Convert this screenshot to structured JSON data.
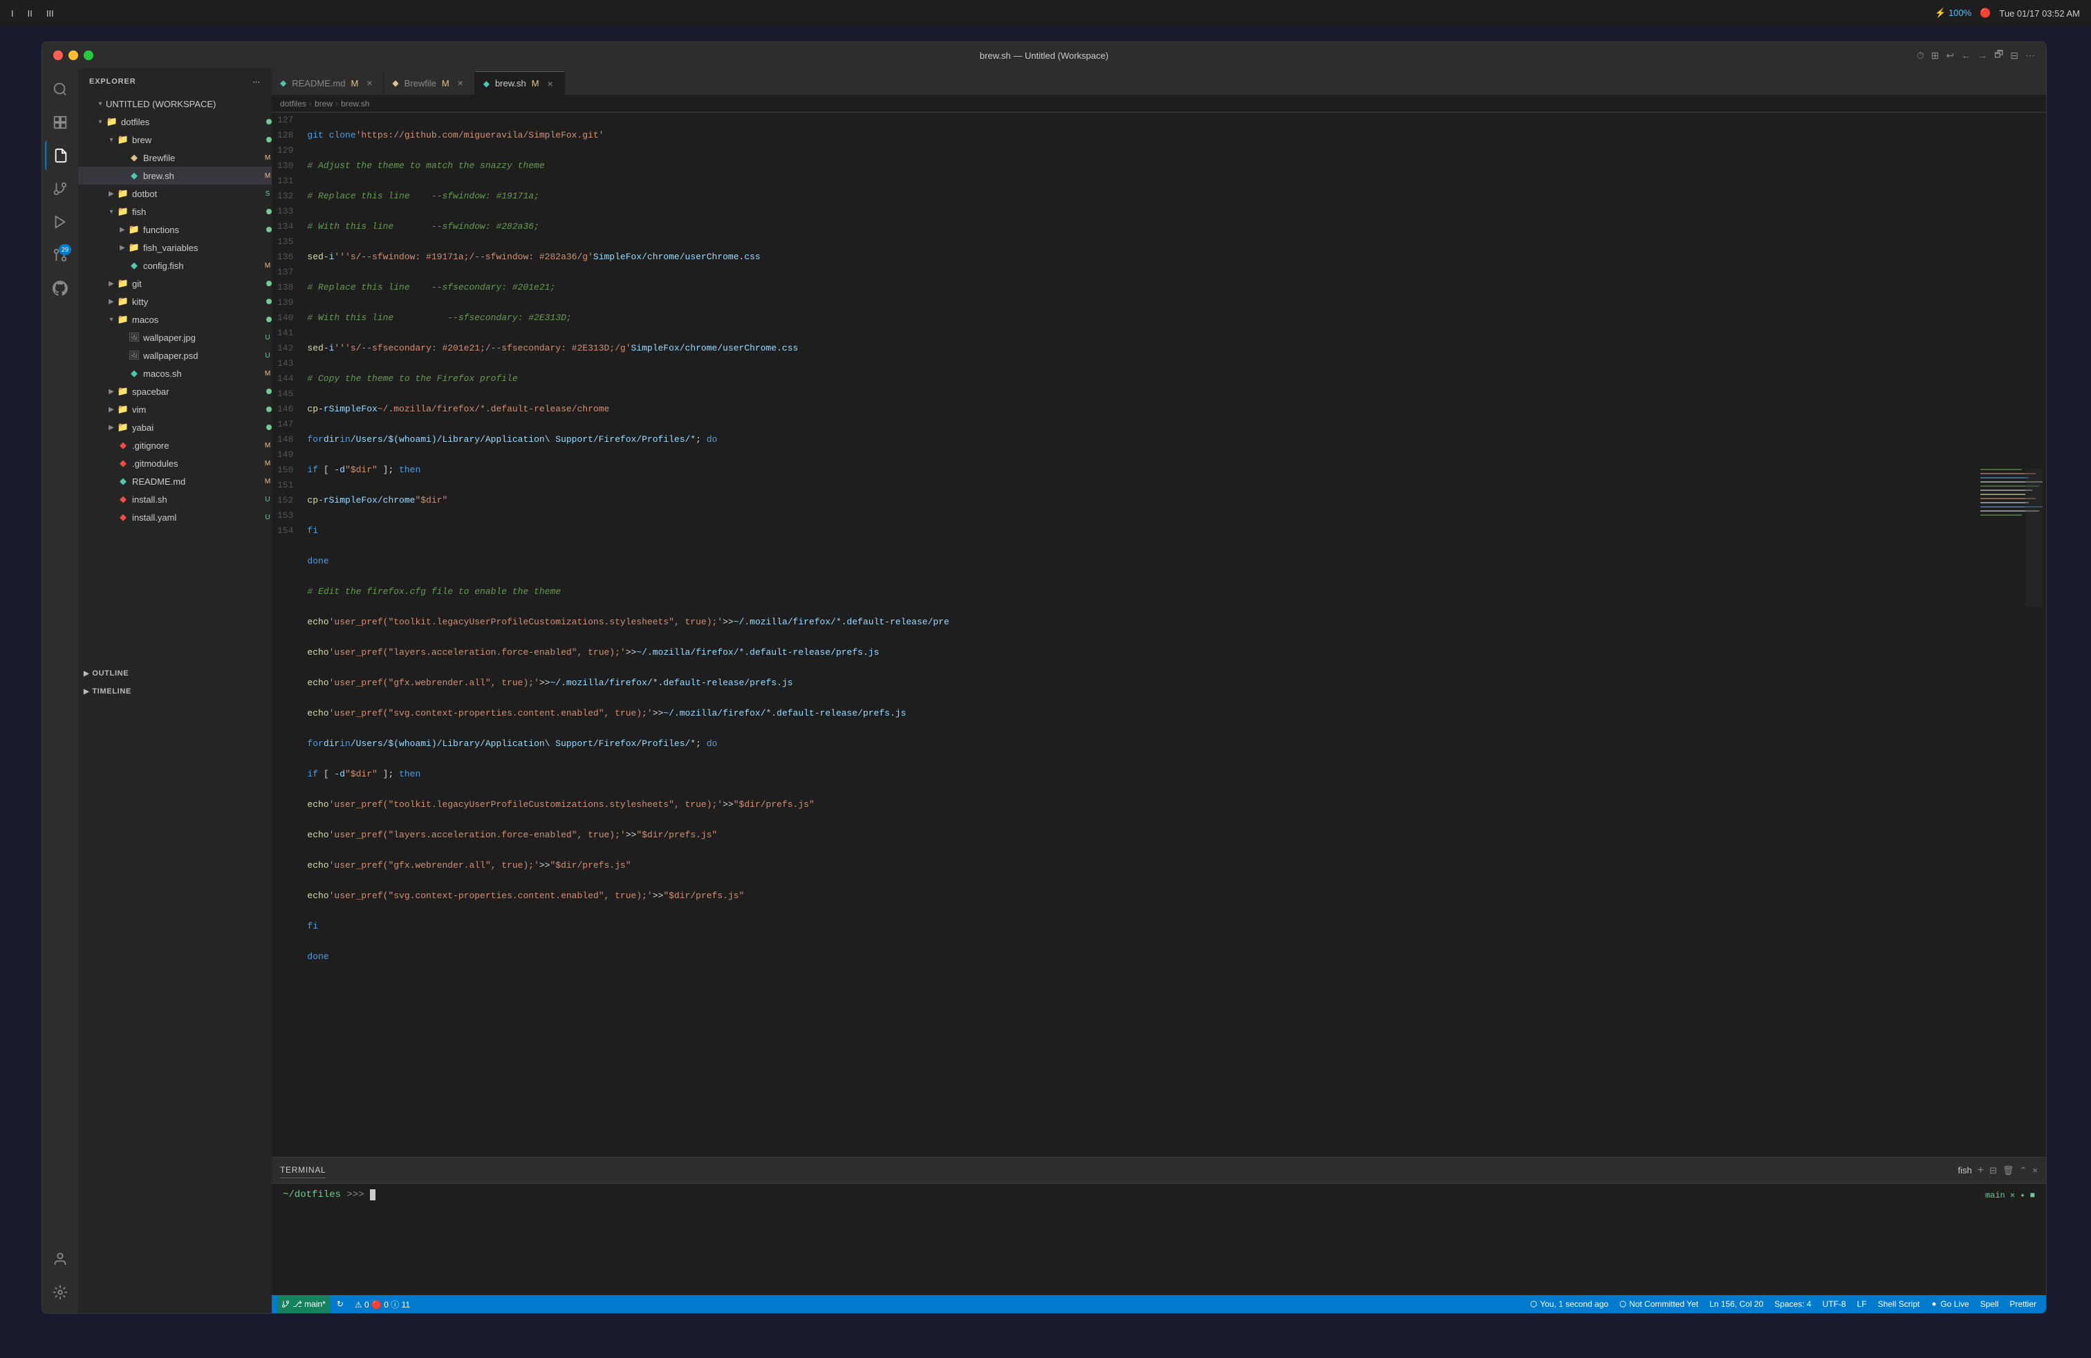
{
  "menu_bar": {
    "items": [
      "I",
      "II",
      "III"
    ],
    "right": {
      "battery": "⚡ 100%",
      "indicator": "🔴",
      "time": "Tue 01/17  03:52 AM"
    }
  },
  "window": {
    "title": "brew.sh — Untitled (Workspace)"
  },
  "tabs": [
    {
      "id": "readme",
      "label": "README.md",
      "modified": true,
      "active": false,
      "icon": "📄",
      "color": "#4ec9b0"
    },
    {
      "id": "brewfile",
      "label": "Brewfile",
      "modified": true,
      "active": false,
      "icon": "📄",
      "color": "#e2c08d"
    },
    {
      "id": "brew",
      "label": "brew.sh",
      "modified": true,
      "active": true,
      "icon": "📄",
      "color": "#4ec9b0"
    }
  ],
  "breadcrumb": {
    "parts": [
      "dotfiles",
      "brew",
      "brew.sh"
    ]
  },
  "sidebar": {
    "title": "EXPLORER",
    "workspace": "UNTITLED (WORKSPACE)",
    "files": [
      {
        "indent": 1,
        "type": "dir",
        "open": true,
        "label": "dotfiles",
        "badge": ""
      },
      {
        "indent": 2,
        "type": "dir",
        "open": true,
        "label": "brew",
        "badge": ""
      },
      {
        "indent": 3,
        "type": "file",
        "label": "Brewfile",
        "badge": "M",
        "badgeClass": "badge-M"
      },
      {
        "indent": 3,
        "type": "file",
        "label": "brew.sh",
        "badge": "M",
        "badgeClass": "badge-M",
        "selected": true
      },
      {
        "indent": 2,
        "type": "dir",
        "open": false,
        "label": "dotbot",
        "badge": "S",
        "badgeClass": "badge-S"
      },
      {
        "indent": 2,
        "type": "dir",
        "open": true,
        "label": "fish",
        "badge": ""
      },
      {
        "indent": 3,
        "type": "dir",
        "open": true,
        "label": "functions",
        "badge": ""
      },
      {
        "indent": 3,
        "type": "dir",
        "open": false,
        "label": "fish_variables",
        "badge": ""
      },
      {
        "indent": 3,
        "type": "file",
        "label": "config.fish",
        "badge": "M",
        "badgeClass": "badge-M"
      },
      {
        "indent": 2,
        "type": "dir",
        "open": false,
        "label": "git",
        "badge": ""
      },
      {
        "indent": 2,
        "type": "dir",
        "open": false,
        "label": "kitty",
        "badge": ""
      },
      {
        "indent": 2,
        "type": "dir",
        "open": true,
        "label": "macos",
        "badge": ""
      },
      {
        "indent": 3,
        "type": "file",
        "label": "wallpaper.jpg",
        "badge": "U",
        "badgeClass": "badge-U"
      },
      {
        "indent": 3,
        "type": "file",
        "label": "wallpaper.psd",
        "badge": "U",
        "badgeClass": "badge-U"
      },
      {
        "indent": 3,
        "type": "file",
        "label": "macos.sh",
        "badge": "M",
        "badgeClass": "badge-M"
      },
      {
        "indent": 2,
        "type": "dir",
        "open": false,
        "label": "spacebar",
        "badge": ""
      },
      {
        "indent": 2,
        "type": "dir",
        "open": false,
        "label": "vim",
        "badge": ""
      },
      {
        "indent": 2,
        "type": "dir",
        "open": false,
        "label": "yabai",
        "badge": ""
      },
      {
        "indent": 2,
        "type": "file",
        "label": ".gitignore",
        "badge": "M",
        "badgeClass": "badge-M"
      },
      {
        "indent": 2,
        "type": "file",
        "label": ".gitmodules",
        "badge": "M",
        "badgeClass": "badge-M"
      },
      {
        "indent": 2,
        "type": "file",
        "label": "README.md",
        "badge": "M",
        "badgeClass": "badge-M"
      },
      {
        "indent": 2,
        "type": "file",
        "label": "install.sh",
        "badge": "U",
        "badgeClass": "badge-U"
      },
      {
        "indent": 2,
        "type": "file",
        "label": "install.yaml",
        "badge": "U",
        "badgeClass": "badge-U"
      }
    ]
  },
  "code_lines": [
    {
      "num": 127,
      "content": "  git clone 'https://github.com/migueravila/SimpleFox.git'"
    },
    {
      "num": 128,
      "content": "  # Adjust the theme to match the snazzy theme"
    },
    {
      "num": 129,
      "content": "  # Replace this line    --sfwindow: #19171a;"
    },
    {
      "num": 130,
      "content": "  # With this line       --sfwindow: #282a36;"
    },
    {
      "num": 131,
      "content": "  sed -i '' 's/--sfwindow: #19171a;/--sfwindow: #282a36/g' SimpleFox/chrome/userChrome.css"
    },
    {
      "num": 132,
      "content": "  # Replace this line    --sfsecondary: #201e21;"
    },
    {
      "num": 133,
      "content": "  # With this line          --sfsecondary: #2E313D;"
    },
    {
      "num": 134,
      "content": "  sed -i '' 's/--sfsecondary: #201e21;/--sfsecondary: #2E313D;/g' SimpleFox/chrome/userChrome.css"
    },
    {
      "num": 135,
      "content": "  # Copy the theme to the Firefox profile"
    },
    {
      "num": 136,
      "content": "  cp -r SimpleFox ~/.mozilla/firefox/*.default-release/chrome"
    },
    {
      "num": 137,
      "content": "  for dir in /Users/$(whoami)/Library/Application\\ Support/Firefox/Profiles/*; do"
    },
    {
      "num": 138,
      "content": "    if [ -d \"$dir\" ]; then"
    },
    {
      "num": 139,
      "content": "      cp -r SimpleFox/chrome \"$dir\""
    },
    {
      "num": 140,
      "content": "    fi"
    },
    {
      "num": 141,
      "content": "  done"
    },
    {
      "num": 142,
      "content": "  # Edit the firefox.cfg file to enable the theme"
    },
    {
      "num": 143,
      "content": "  echo 'user_pref(\"toolkit.legacyUserProfileCustomizations.stylesheets\", true);' >> ~/.mozilla/firefox/*.default-release/pre"
    },
    {
      "num": 144,
      "content": "  echo 'user_pref(\"layers.acceleration.force-enabled\", true);' >> ~/.mozilla/firefox/*.default-release/prefs.js"
    },
    {
      "num": 145,
      "content": "  echo 'user_pref(\"gfx.webrender.all\", true);' >> ~/.mozilla/firefox/*.default-release/prefs.js"
    },
    {
      "num": 146,
      "content": "  echo 'user_pref(\"svg.context-properties.content.enabled\", true);' >> ~/.mozilla/firefox/*.default-release/prefs.js"
    },
    {
      "num": 147,
      "content": "  for dir in /Users/$(whoami)/Library/Application\\ Support/Firefox/Profiles/*; do"
    },
    {
      "num": 148,
      "content": "    if [ -d \"$dir\" ]; then"
    },
    {
      "num": 149,
      "content": "      echo 'user_pref(\"toolkit.legacyUserProfileCustomizations.stylesheets\", true);' >> \"$dir/prefs.js\""
    },
    {
      "num": 150,
      "content": "      echo 'user_pref(\"layers.acceleration.force-enabled\", true);' >> \"$dir/prefs.js\""
    },
    {
      "num": 151,
      "content": "      echo 'user_pref(\"gfx.webrender.all\", true);' >> \"$dir/prefs.js\""
    },
    {
      "num": 152,
      "content": "      echo 'user_pref(\"svg.context-properties.content.enabled\", true);' >> \"$dir/prefs.js\""
    },
    {
      "num": 153,
      "content": "    fi"
    },
    {
      "num": 154,
      "content": "  done"
    }
  ],
  "terminal": {
    "tab_label": "TERMINAL",
    "shell": "fish",
    "prompt_path": "~/dotfiles",
    "prompt_symbol": ">>>",
    "right_text": "main ✕ ✦ ■"
  },
  "status_bar": {
    "branch": "⎇ main*",
    "sync": "↻",
    "warnings": "⚠ 0  🔴 0  ⓘ 11",
    "git_info": "You, 1 second ago",
    "git_status": "Not Committed Yet",
    "cursor": "Ln 156, Col 20",
    "spaces": "Spaces: 4",
    "encoding": "UTF-8",
    "eol": "LF",
    "language": "Shell Script",
    "live": "Go Live",
    "spell": "Spell",
    "prettier": "Prettier"
  },
  "sections": {
    "outline": "OUTLINE",
    "timeline": "TIMELINE"
  },
  "activity_bar": {
    "items": [
      {
        "id": "search",
        "icon": "🔍",
        "label": "Search"
      },
      {
        "id": "extensions",
        "icon": "⚙",
        "label": "Extensions"
      },
      {
        "id": "explorer",
        "icon": "📄",
        "label": "Explorer",
        "active": true
      },
      {
        "id": "source-control",
        "icon": "🗂",
        "label": "Source Control"
      },
      {
        "id": "debug",
        "icon": "▶",
        "label": "Run and Debug"
      },
      {
        "id": "source-control-2",
        "icon": "⑂",
        "label": "Source Control",
        "badge": "29"
      },
      {
        "id": "github",
        "icon": "🐙",
        "label": "GitHub"
      }
    ]
  }
}
